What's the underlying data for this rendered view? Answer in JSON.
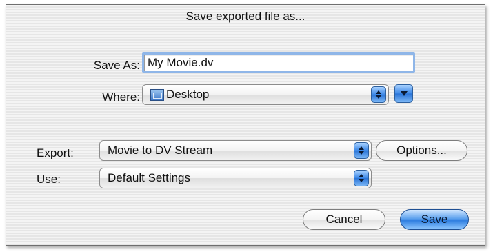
{
  "dialog": {
    "title": "Save exported file as..."
  },
  "save_as": {
    "label": "Save As:",
    "value": "My Movie.dv"
  },
  "where": {
    "label": "Where:",
    "value": "Desktop",
    "icon": "desktop-folder-icon"
  },
  "export": {
    "label": "Export:",
    "value": "Movie to DV Stream",
    "options_label": "Options..."
  },
  "use": {
    "label": "Use:",
    "value": "Default Settings"
  },
  "buttons": {
    "cancel": "Cancel",
    "save": "Save"
  },
  "colors": {
    "accent_blue": "#3a86e6",
    "focus_ring": "#8fb6e8"
  }
}
